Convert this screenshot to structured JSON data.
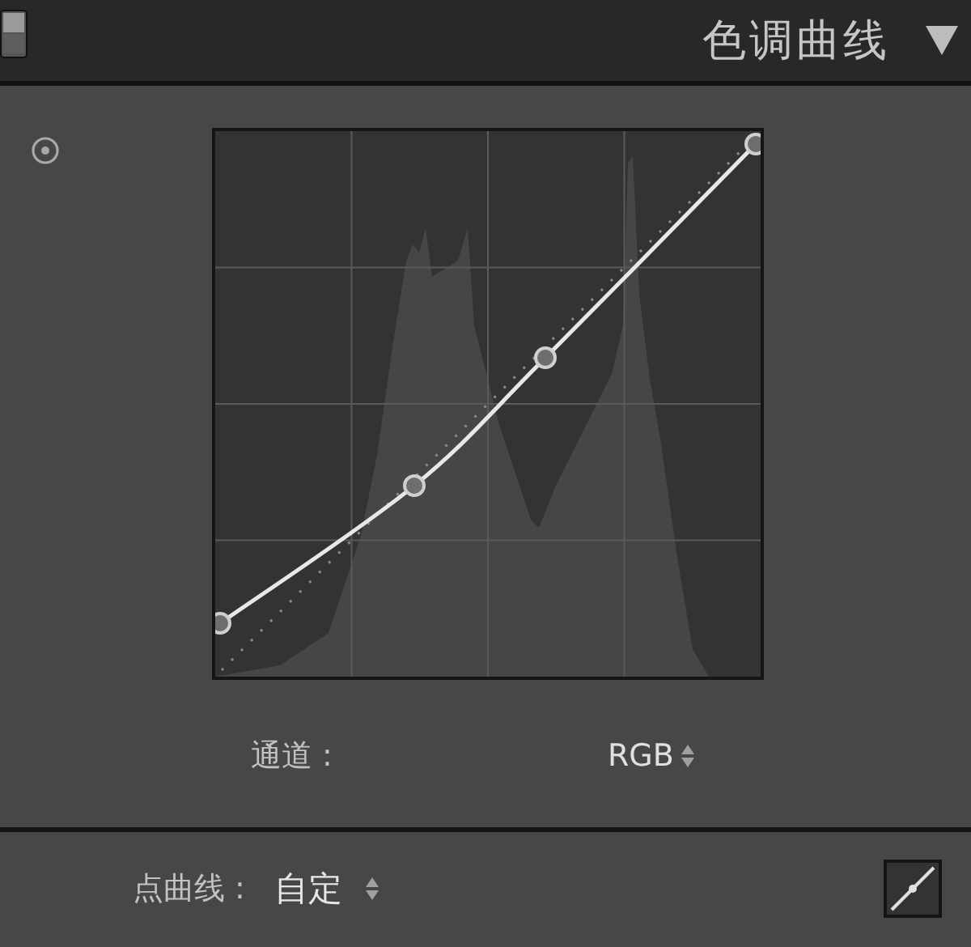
{
  "header": {
    "title": "色调曲线"
  },
  "channel": {
    "label": "通道 :",
    "value": "RGB"
  },
  "point_curve": {
    "label": "点曲线 :",
    "value": "自定"
  }
}
